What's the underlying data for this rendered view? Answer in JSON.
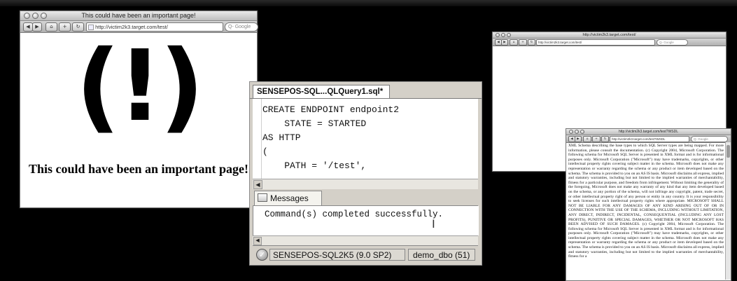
{
  "browser_main": {
    "title": "This could have been an important page!",
    "nav": {
      "back": "◀",
      "forward": "▶",
      "home": "⌂",
      "add": "+",
      "reload": "↻"
    },
    "url": "http://victim2k3.target.com/test/",
    "search_placeholder": "Q- Google",
    "bang": "(!)",
    "message": "This could have been an important page!"
  },
  "browser_small": {
    "title": "http://victim2k3.target.com/test/",
    "nav": {
      "back": "◀",
      "forward": "▶",
      "home": "⌂",
      "add": "+",
      "reload": "↻"
    },
    "url": "http://victim2k3.target.com/test/",
    "search_placeholder": "Q- Google"
  },
  "browser_wsdl": {
    "title": "http://victim2k3.target.com/test?WSDL",
    "nav": {
      "back": "◀",
      "forward": "▶",
      "home": "⌂",
      "add": "+",
      "reload": "↻"
    },
    "url": "http://victim2k3.target.com/test?WSDL",
    "search_placeholder": "Q- Google",
    "body": "XML Schema describing the base types to which SQL Server types are being mapped. For more information, please consult the documentation. (c) Copyright 2004, Microsoft Corporation. The following schema for Microsoft SQL Server is presented in XML format and is for informational purposes only. Microsoft Corporation (\"Microsoft\") may have trademarks, copyrights, or other intellectual property rights covering subject matter in the schema. Microsoft does not make any representation or warranty regarding the schema or any product or item developed based on the schema. The schema is provided to you on an AS IS basis. Microsoft disclaims all express, implied and statutory warranties, including but not limited to the implied warranties of merchantability, fitness for a particular purpose, and freedom from infringement. Without limiting the generality of the foregoing, Microsoft does not make any warranty of any kind that any item developed based on the schema, or any portion of the schema, will not infringe any copyright, patent, trade secret, or other intellectual property right of any person or entity in any country. It is your responsibility to seek licenses for such intellectual property rights where appropriate. MICROSOFT SHALL NOT BE LIABLE FOR ANY DAMAGES OF ANY KIND ARISING OUT OF OR IN CONNECTION WITH THE USE OF THE SCHEMA, INCLUDING WITHOUT LIMITATION, ANY DIRECT, INDIRECT, INCIDENTAL, CONSEQUENTIAL (INCLUDING ANY LOST PROFITS), PUNITIVE OR SPECIAL DAMAGES, WHETHER OR NOT MICROSOFT HAS BEEN ADVISED OF SUCH DAMAGES. (c) Copyright 2004, Microsoft Corporation. The following schema for Microsoft SQL Server is presented in XML format and is for informational purposes only. Microsoft Corporation (\"Microsoft\") may have trademarks, copyrights, or other intellectual property rights covering subject matter in the schema. Microsoft does not make any representation or warranty regarding the schema or any product or item developed based on the schema. The schema is provided to you on an AS IS basis. Microsoft disclaims all express, implied and statutory warranties, including but not limited to the implied warranties of merchantability, fitness for a"
  },
  "ssms": {
    "tab_title": "SENSEPOS-SQL...QLQuery1.sql*",
    "code": "CREATE ENDPOINT endpoint2\n    STATE = STARTED\nAS HTTP\n(\n    PATH = '/test',",
    "messages_tab": "Messages",
    "message_text": "Command(s) completed successfully.",
    "status_server": "SENSEPOS-SQL2K5 (9.0 SP2)",
    "status_db": "demo_dbo (51)"
  }
}
